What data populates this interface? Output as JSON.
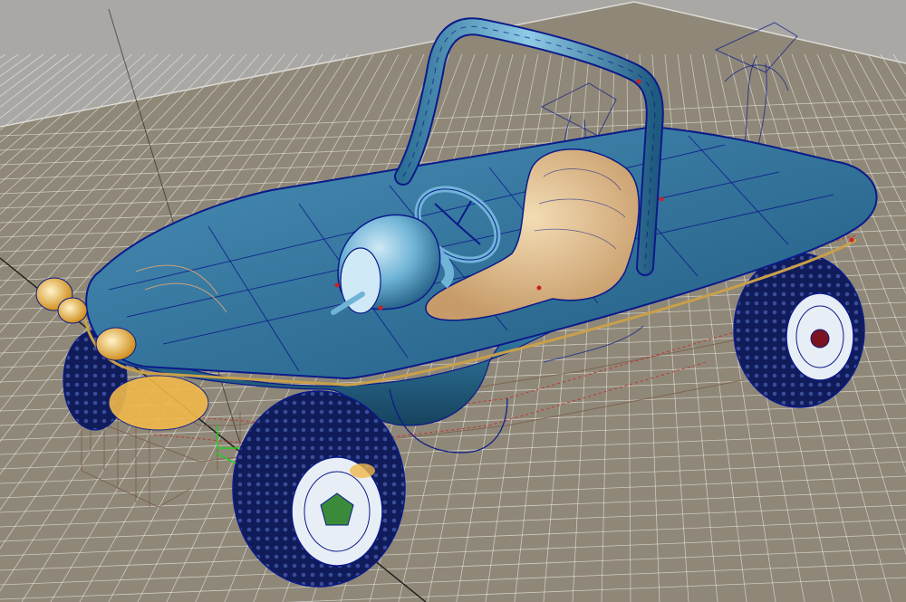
{
  "viewport": {
    "view": "perspective",
    "display_mode": "wireframe-on-shaded",
    "background_color": "#a9a8a5",
    "ground_color": "#8f8878",
    "grid_color": "#ffffff",
    "axis_color": "#1a1a1a",
    "wire_color": "#0b1a8a"
  },
  "model": {
    "subject": "dune buggy",
    "body_color": "#2c6f95",
    "body_highlight": "#6fb4d6",
    "seat_color": "#e9c99a",
    "tire_color": "#101c5a",
    "rim_color": "#e8eef5",
    "headlight_color": "#f0b84a",
    "selection_color": "#cc2222",
    "manipulator_color": "#22cc22",
    "parts": [
      "roll-bar",
      "deck",
      "steering-wheel",
      "dashboard-pod",
      "seat",
      "front-left-wheel",
      "rear-right-wheel",
      "rear-left-wheel",
      "headlights",
      "chassis-frame",
      "driver-reference-wireframes"
    ]
  }
}
